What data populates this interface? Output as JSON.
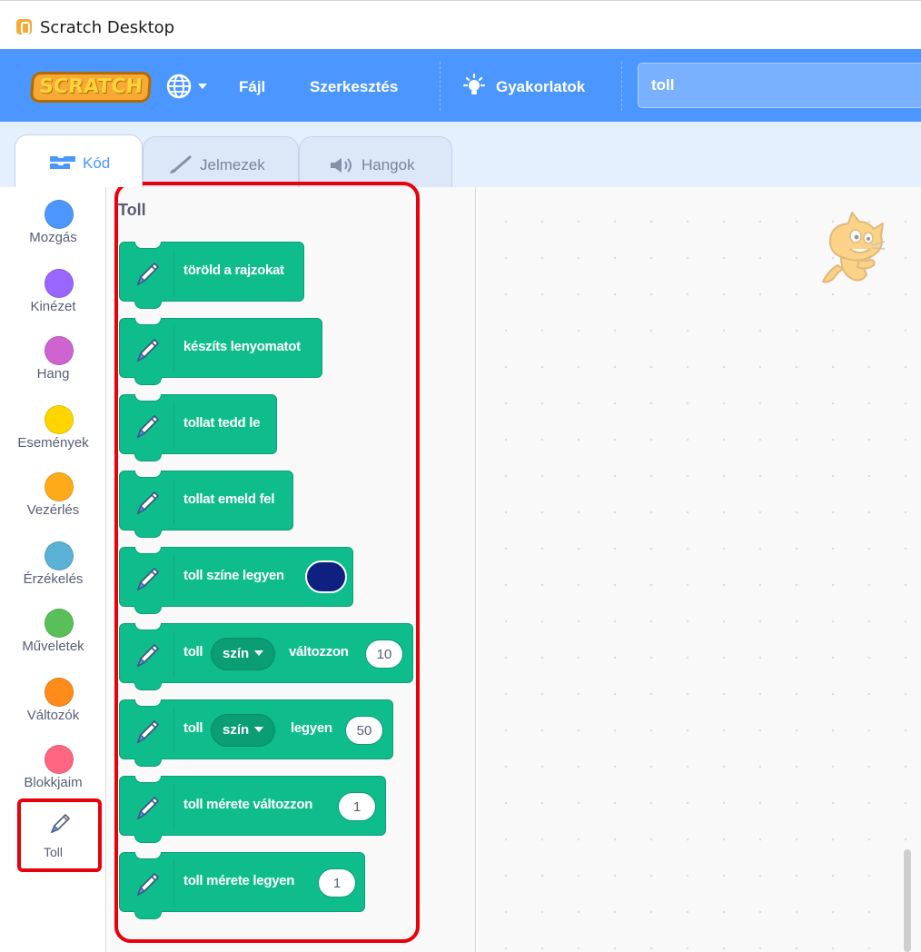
{
  "window": {
    "title": "Scratch Desktop"
  },
  "menubar": {
    "logo": "SCRATCH",
    "file": "Fájl",
    "edit": "Szerkesztés",
    "tutorials": "Gyakorlatok",
    "project_title": "toll"
  },
  "tabs": [
    {
      "label": "Kód",
      "active": true
    },
    {
      "label": "Jelmezek",
      "active": false
    },
    {
      "label": "Hangok",
      "active": false
    }
  ],
  "categories": [
    {
      "label": "Mozgás",
      "color": "#4c97ff"
    },
    {
      "label": "Kinézet",
      "color": "#9966ff"
    },
    {
      "label": "Hang",
      "color": "#cf63cf"
    },
    {
      "label": "Események",
      "color": "#ffd500"
    },
    {
      "label": "Vezérlés",
      "color": "#ffab19"
    },
    {
      "label": "Érzékelés",
      "color": "#5cb1d6"
    },
    {
      "label": "Műveletek",
      "color": "#59c059"
    },
    {
      "label": "Változók",
      "color": "#ff8c1a"
    },
    {
      "label": "Blokkjaim",
      "color": "#ff6680"
    },
    {
      "label": "Toll",
      "selected": true
    }
  ],
  "palette": {
    "title": "Toll",
    "blocks": {
      "clear": {
        "text": "töröld a rajzokat"
      },
      "stamp": {
        "text": "készíts lenyomatot"
      },
      "pen_down": {
        "text": "tollat tedd le"
      },
      "pen_up": {
        "text": "tollat emeld fel"
      },
      "set_color": {
        "text": "toll színe legyen",
        "color": "#0f2080"
      },
      "change_param": {
        "prefix": "toll",
        "dropdown": "szín",
        "suffix": "változzon",
        "value": "10"
      },
      "set_param": {
        "prefix": "toll",
        "dropdown": "szín",
        "suffix": "legyen",
        "value": "50"
      },
      "change_size": {
        "text": "toll mérete változzon",
        "value": "1"
      },
      "set_size": {
        "text": "toll mérete legyen",
        "value": "1"
      }
    }
  },
  "colors": {
    "menubar": "#4c97ff",
    "pen_block": "#0fbd8c",
    "highlight": "#e8000b"
  }
}
